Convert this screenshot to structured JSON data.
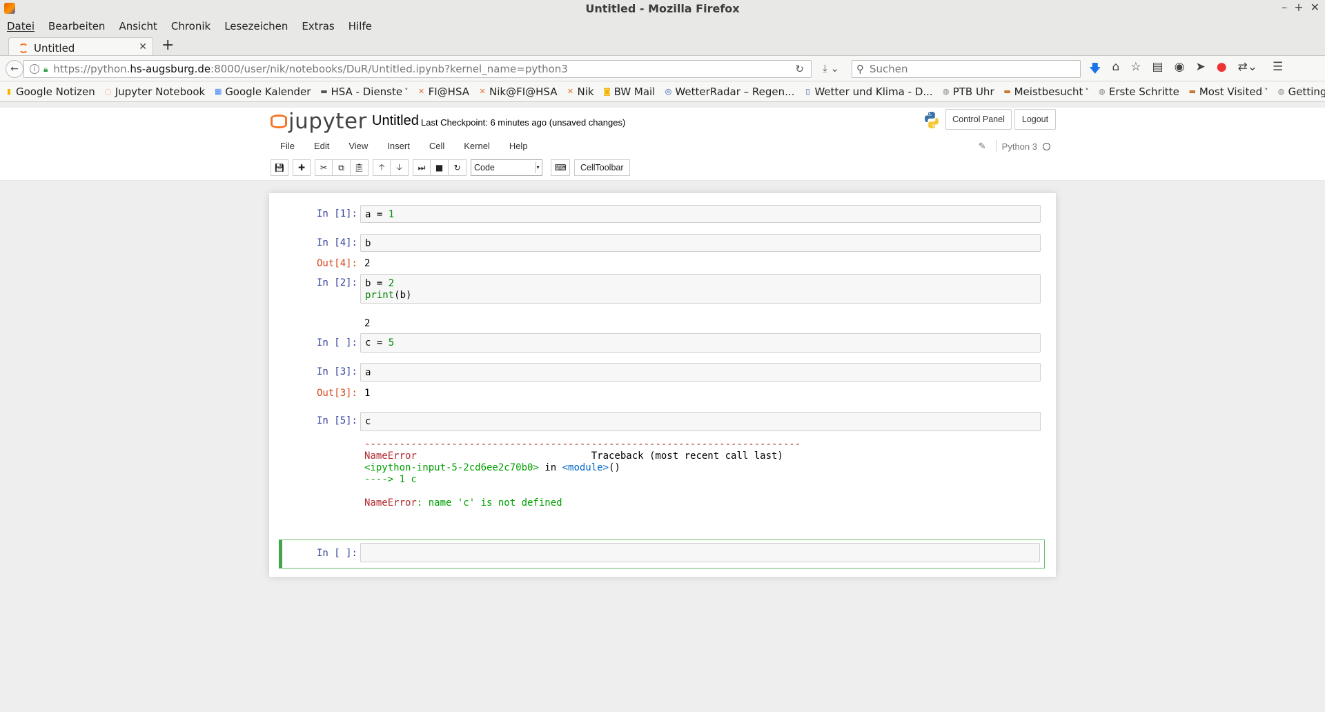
{
  "window": {
    "title": "Untitled - Mozilla Firefox",
    "controls": [
      "–",
      "+",
      "✕"
    ]
  },
  "menubar": {
    "items": [
      "Datei",
      "Bearbeiten",
      "Ansicht",
      "Chronik",
      "Lesezeichen",
      "Extras",
      "Hilfe"
    ]
  },
  "tab": {
    "label": "Untitled",
    "close": "✕",
    "new": "+"
  },
  "navbar": {
    "url_prefix": "https://python.",
    "url_host": "hs-augsburg.de",
    "url_suffix": ":8000/user/nik/notebooks/DuR/Untitled.ipynb?kernel_name=python3",
    "search_placeholder": "Suchen"
  },
  "bookmarks": [
    {
      "label": "Google Notizen",
      "icon": "keep-icon",
      "color": "#f4b400",
      "glyph": "▮",
      "dropdown": false
    },
    {
      "label": "Jupyter Notebook",
      "icon": "jupyter-icon",
      "color": "#f37626",
      "glyph": "◌",
      "dropdown": false
    },
    {
      "label": "Google Kalender",
      "icon": "calendar-icon",
      "color": "#4285f4",
      "glyph": "▦",
      "dropdown": false
    },
    {
      "label": "HSA - Dienste",
      "icon": "folder-icon",
      "color": "#555555",
      "glyph": "▬",
      "dropdown": true
    },
    {
      "label": "FI@HSA",
      "icon": "fi-icon",
      "color": "#e0702a",
      "glyph": "✕",
      "dropdown": false
    },
    {
      "label": "Nik@FI@HSA",
      "icon": "fi-icon",
      "color": "#e0702a",
      "glyph": "✕",
      "dropdown": false
    },
    {
      "label": "Nik",
      "icon": "fi-icon",
      "color": "#e0702a",
      "glyph": "✕",
      "dropdown": false
    },
    {
      "label": "BW Mail",
      "icon": "mail-icon",
      "color": "#f4b400",
      "glyph": "◙",
      "dropdown": false
    },
    {
      "label": "WetterRadar – Regen...",
      "icon": "globe-icon",
      "color": "#2255aa",
      "glyph": "◎",
      "dropdown": false
    },
    {
      "label": "Wetter und Klima - D...",
      "icon": "dwd-icon",
      "color": "#334a9e",
      "glyph": "▯",
      "dropdown": false
    },
    {
      "label": "PTB Uhr",
      "icon": "globe-icon",
      "color": "#888888",
      "glyph": "◍",
      "dropdown": false
    },
    {
      "label": "Meistbesucht",
      "icon": "folder-icon",
      "color": "#c9772b",
      "glyph": "▬",
      "dropdown": true
    },
    {
      "label": "Erste Schritte",
      "icon": "globe-icon",
      "color": "#888888",
      "glyph": "◍",
      "dropdown": false
    },
    {
      "label": "Most Visited",
      "icon": "folder-icon",
      "color": "#c9772b",
      "glyph": "▬",
      "dropdown": true
    },
    {
      "label": "Getting Started",
      "icon": "globe-icon",
      "color": "#888888",
      "glyph": "◍",
      "dropdown": false
    }
  ],
  "jupyter": {
    "logo_text": "jupyter",
    "notebook_title": "Untitled",
    "checkpoint": "Last Checkpoint: 6 minutes ago (unsaved changes)",
    "control_panel": "Control Panel",
    "logout": "Logout",
    "menu": [
      "File",
      "Edit",
      "View",
      "Insert",
      "Cell",
      "Kernel",
      "Help"
    ],
    "kernel_name": "Python 3",
    "cell_type": "Code",
    "celltoolbar": "CellToolbar"
  },
  "cells": [
    {
      "prompt": "In [1]:",
      "code": [
        "a = ",
        "1"
      ],
      "output_prompt": "",
      "output": ""
    },
    {
      "prompt": "In [4]:",
      "code": [
        "b"
      ],
      "output_prompt": "Out[4]:",
      "output": "2"
    },
    {
      "prompt": "In [2]:",
      "code_line1": [
        "b = ",
        "2"
      ],
      "code_line2": [
        "print",
        "(b)"
      ],
      "output": "2"
    },
    {
      "prompt": "In [ ]:",
      "code": [
        "c = ",
        "5"
      ]
    },
    {
      "prompt": "In [3]:",
      "code": [
        "a"
      ],
      "output_prompt": "Out[3]:",
      "output": "1"
    },
    {
      "prompt": "In [5]:",
      "code": [
        "c"
      ],
      "traceback": {
        "dashes": "---------------------------------------------------------------------------",
        "err_name": "NameError",
        "header_right": "                              Traceback (most recent call last)",
        "input_ref": "<ipython-input-5-2cd6ee2c70b0>",
        "in_word": " in ",
        "module": "<module>",
        "paren": "()",
        "arrow_line": "----> 1 c",
        "final_name": "NameError",
        "final_msg": ": name 'c' is not defined"
      }
    },
    {
      "prompt": "In [ ]:",
      "code": []
    }
  ]
}
